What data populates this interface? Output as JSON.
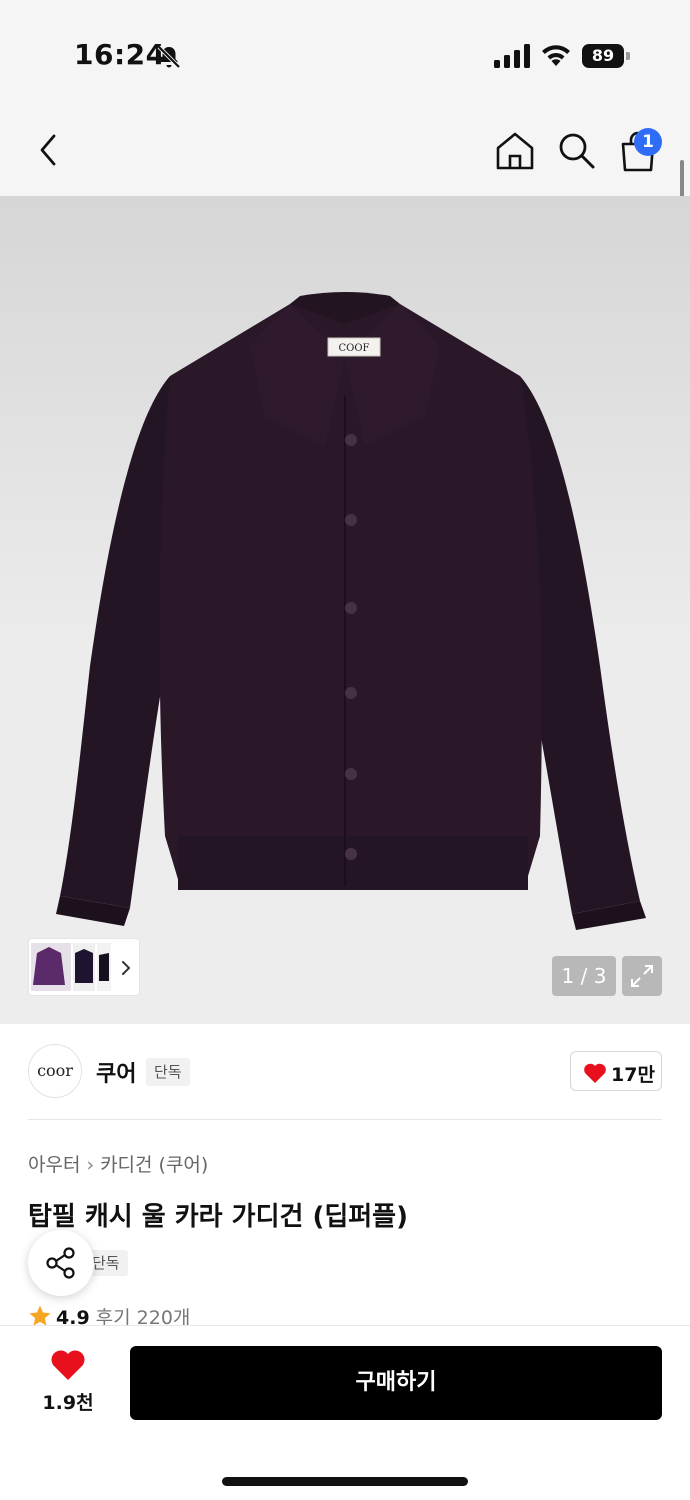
{
  "status_bar": {
    "time": "16:24",
    "battery": "89"
  },
  "header": {
    "cart_count": "1"
  },
  "gallery": {
    "logo_label": "COOF",
    "counter": "1 / 3"
  },
  "brand": {
    "logo_text": "coor",
    "name": "쿠어",
    "tag": "단독",
    "likes": "17만"
  },
  "product": {
    "breadcrumb": [
      "아우터",
      "카디건 (쿠어)"
    ],
    "title": "탑필 캐시 울 카라 가디건 (딥퍼플)",
    "tag": "단독",
    "rating": "4.9",
    "reviews": "후기 220개"
  },
  "bottom_bar": {
    "wish_count": "1.9천",
    "buy_label": "구매하기"
  },
  "colors": {
    "garment": "#2a1828",
    "buy_button": "#000000",
    "heart": "#e8101c",
    "badge": "#2f6df6",
    "star": "#f5a623"
  }
}
